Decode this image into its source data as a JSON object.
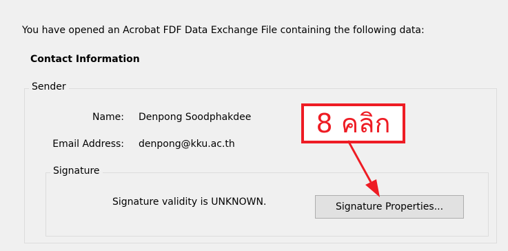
{
  "dialog": {
    "intro_text": "You have opened an Acrobat FDF Data Exchange File containing the following data:",
    "section_title": "Contact Information"
  },
  "sender": {
    "legend": "Sender",
    "name_label": "Name:",
    "name_value": "Denpong Soodphakdee",
    "email_label": "Email Address:",
    "email_value": "denpong@kku.ac.th"
  },
  "signature": {
    "legend": "Signature",
    "status_text": "Signature validity is UNKNOWN.",
    "button_label": "Signature Properties..."
  },
  "annotation": {
    "text": "8 คลิก",
    "color": "#ee1c24"
  }
}
